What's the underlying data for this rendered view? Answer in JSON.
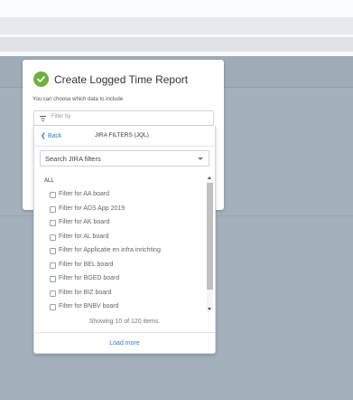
{
  "dialog": {
    "title": "Create Logged Time Report",
    "subtitle": "You can choose which data to include",
    "filter_placeholder": "Filter by"
  },
  "dropdown": {
    "back_label": "Back",
    "title": "JIRA FILTERS (JQL)",
    "search_value": "Search JIRA filters",
    "group_label": "ALL",
    "items": [
      "Filter for AA board",
      "Filter for ADS App 2019",
      "Filter for AK board",
      "Filter for AL board",
      "Filter for Applicatie en infra inrichting",
      "Filter for BEL board",
      "Filter for BGED board",
      "Filter for BIZ board",
      "Filter for BNBV board"
    ],
    "showing_text": "Showing 10 of 120 items.",
    "load_more_label": "Load more"
  },
  "colors": {
    "accent": "#2f7ec4",
    "success": "#6fb03f",
    "backdrop": "#a4b1bc"
  },
  "icons": [
    "check-circle-icon",
    "filter-icon",
    "chevron-left-icon",
    "caret-down-icon"
  ]
}
